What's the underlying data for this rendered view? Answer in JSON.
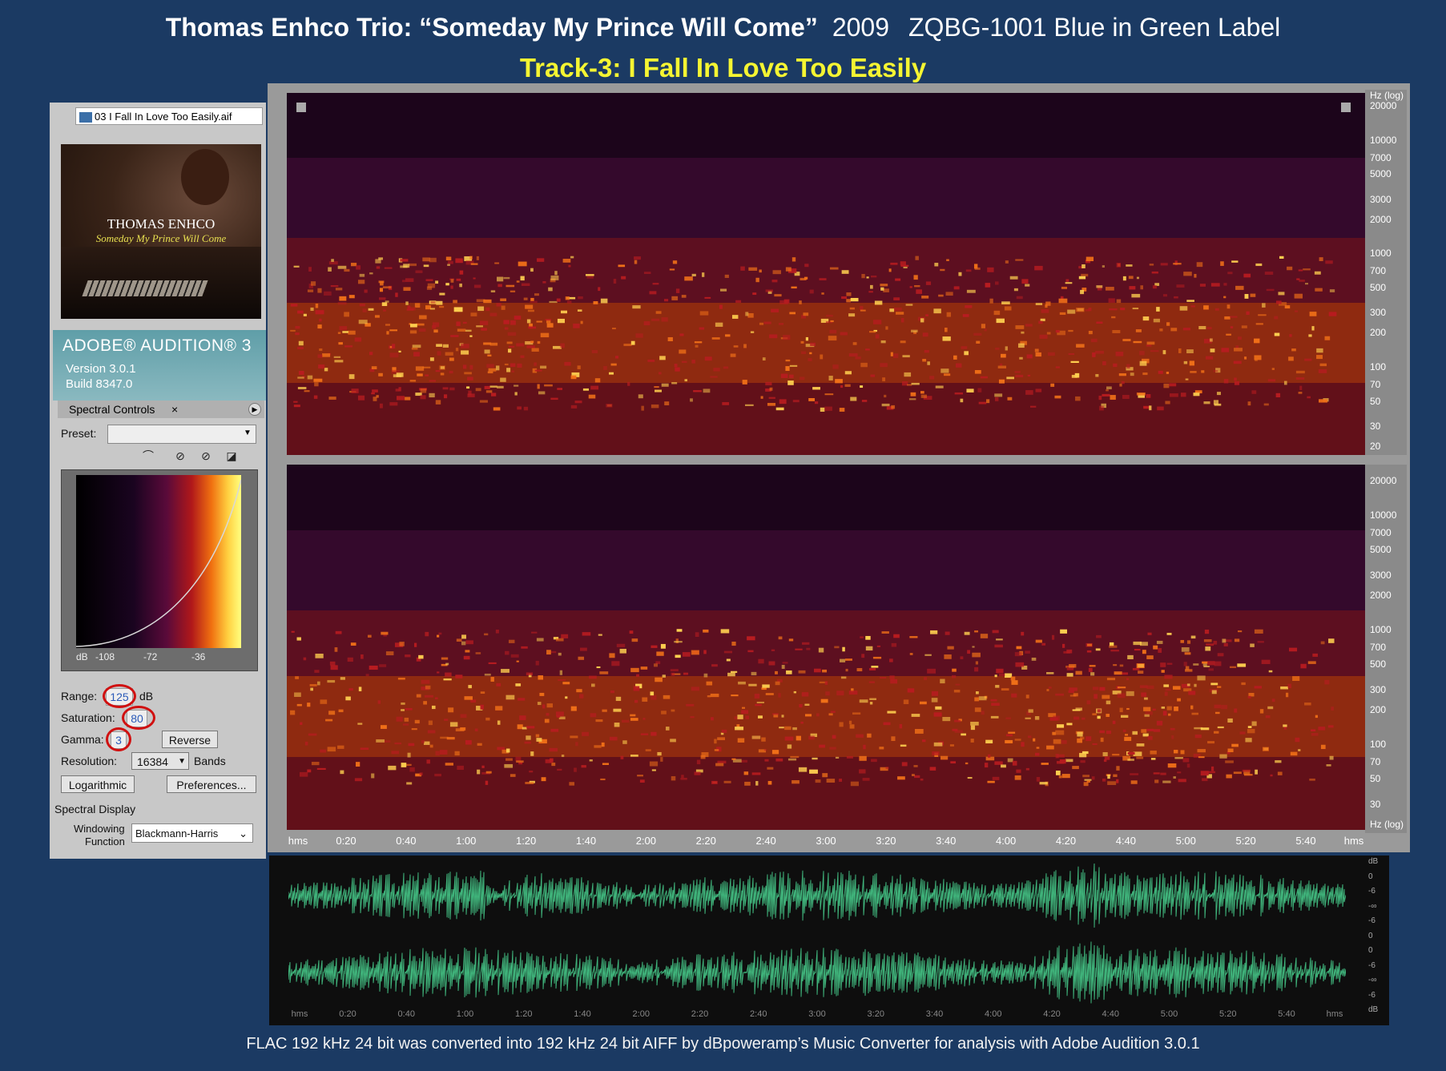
{
  "header": {
    "title": "Thomas Enhco Trio: “Someday My Prince Will Come”",
    "year": "2009",
    "label": "ZQBG-1001 Blue in Green Label",
    "track": "Track-3: I Fall In Love Too Easily"
  },
  "footer": "FLAC 192 kHz 24 bit was converted into 192 kHz 24 bit AIFF by dBpoweramp’s Music Converter for analysis with Adobe Audition 3.0.1",
  "file_tab": "03 I Fall In Love Too Easily.aif",
  "cover": {
    "title": "THOMAS ENHCO",
    "subtitle": "Someday My Prince Will Come"
  },
  "app": {
    "name": "ADOBE® AUDITION® 3",
    "version": "Version 3.0.1",
    "build": "Build 8347.0"
  },
  "spectral_controls": {
    "tab": "Spectral Controls",
    "close": "×",
    "preset_label": "Preset:",
    "preset_value": "",
    "db_ticks": [
      "dB",
      "-108",
      "-72",
      "-36"
    ],
    "range_label": "Range:",
    "range_value": "125",
    "range_unit": "dB",
    "saturation_label": "Saturation:",
    "saturation_value": "80",
    "gamma_label": "Gamma:",
    "gamma_value": "3",
    "reverse": "Reverse",
    "resolution_label": "Resolution:",
    "resolution_value": "16384",
    "resolution_unit": "Bands",
    "logarithmic": "Logarithmic",
    "preferences": "Preferences..."
  },
  "spectral_display": {
    "label": "Spectral Display",
    "windowing_1": "Windowing",
    "windowing_2": "Function",
    "windowing_value": "Blackmann-Harris"
  },
  "hz_axis_top": [
    "Hz (log)",
    "20000",
    "10000",
    "7000",
    "5000",
    "3000",
    "2000",
    "1000",
    "700",
    "500",
    "300",
    "200",
    "100",
    "70",
    "50",
    "30",
    "20"
  ],
  "hz_axis_bottom": [
    "20000",
    "10000",
    "7000",
    "5000",
    "3000",
    "2000",
    "1000",
    "700",
    "500",
    "300",
    "200",
    "100",
    "70",
    "50",
    "30",
    "Hz (log)"
  ],
  "time_axis": [
    "hms",
    "0:20",
    "0:40",
    "1:00",
    "1:20",
    "1:40",
    "2:00",
    "2:20",
    "2:40",
    "3:00",
    "3:20",
    "3:40",
    "4:00",
    "4:20",
    "4:40",
    "5:00",
    "5:20",
    "5:40",
    "hms"
  ],
  "db_axis": [
    "dB",
    "0",
    "-6",
    "-∞",
    "-6",
    "0",
    "0",
    "-6",
    "-∞",
    "-6",
    "dB"
  ],
  "colors": {
    "background": "#1b3a63",
    "track": "#f5f532",
    "waveform": "#3fb27a"
  }
}
